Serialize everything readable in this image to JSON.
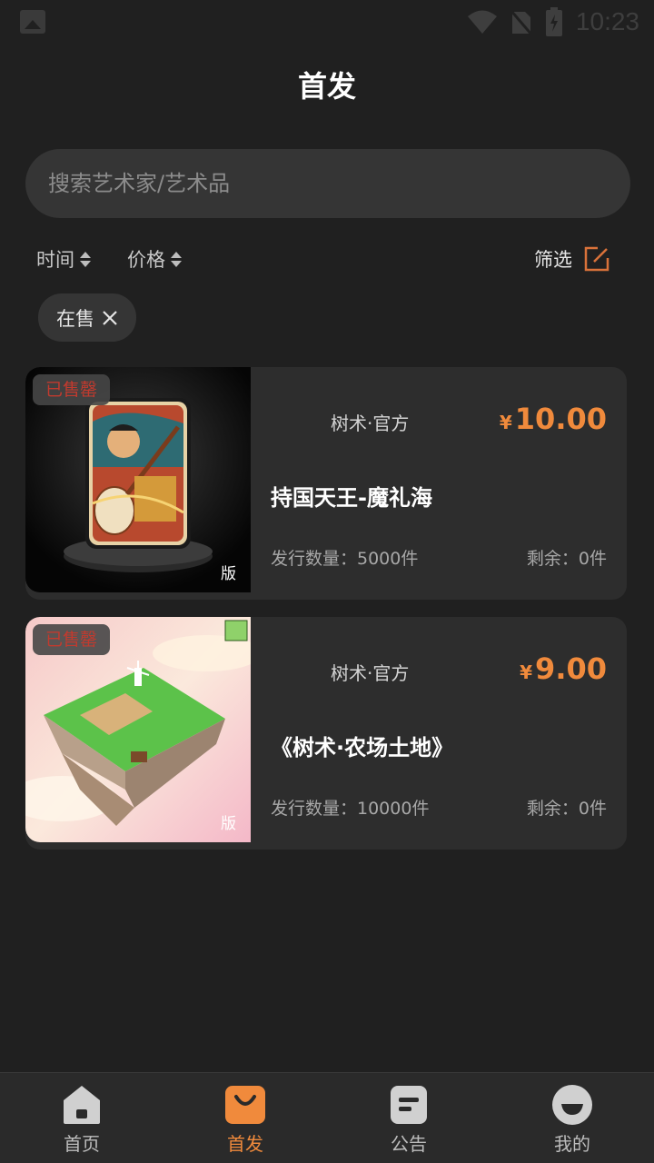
{
  "status_bar": {
    "time": "10:23"
  },
  "header": {
    "title": "首发"
  },
  "search": {
    "placeholder": "搜索艺术家/艺术品"
  },
  "sort": {
    "time_label": "时间",
    "price_label": "价格",
    "filter_label": "筛选"
  },
  "active_filter": {
    "label": "在售"
  },
  "products": [
    {
      "badge": "已售罄",
      "watermark": "版",
      "issuer": "树术·官方",
      "currency": "¥",
      "price": "10.00",
      "name": "持国天王-魔礼海",
      "quantity": "发行数量：5000件",
      "remaining": "剩余：0件"
    },
    {
      "badge": "已售罄",
      "watermark": "版",
      "issuer": "树术·官方",
      "currency": "¥",
      "price": "9.00",
      "name": "《树术·农场土地》",
      "quantity": "发行数量：10000件",
      "remaining": "剩余：0件"
    }
  ],
  "tabbar": [
    {
      "label": "首页",
      "icon": "home-icon",
      "active": false
    },
    {
      "label": "首发",
      "icon": "bag-icon",
      "active": true
    },
    {
      "label": "公告",
      "icon": "notice-icon",
      "active": false
    },
    {
      "label": "我的",
      "icon": "profile-icon",
      "active": false
    }
  ],
  "colors": {
    "background": "#202020",
    "accent": "#f08a3c",
    "sold": "#c23a2e",
    "card": "#2d2d2d"
  }
}
